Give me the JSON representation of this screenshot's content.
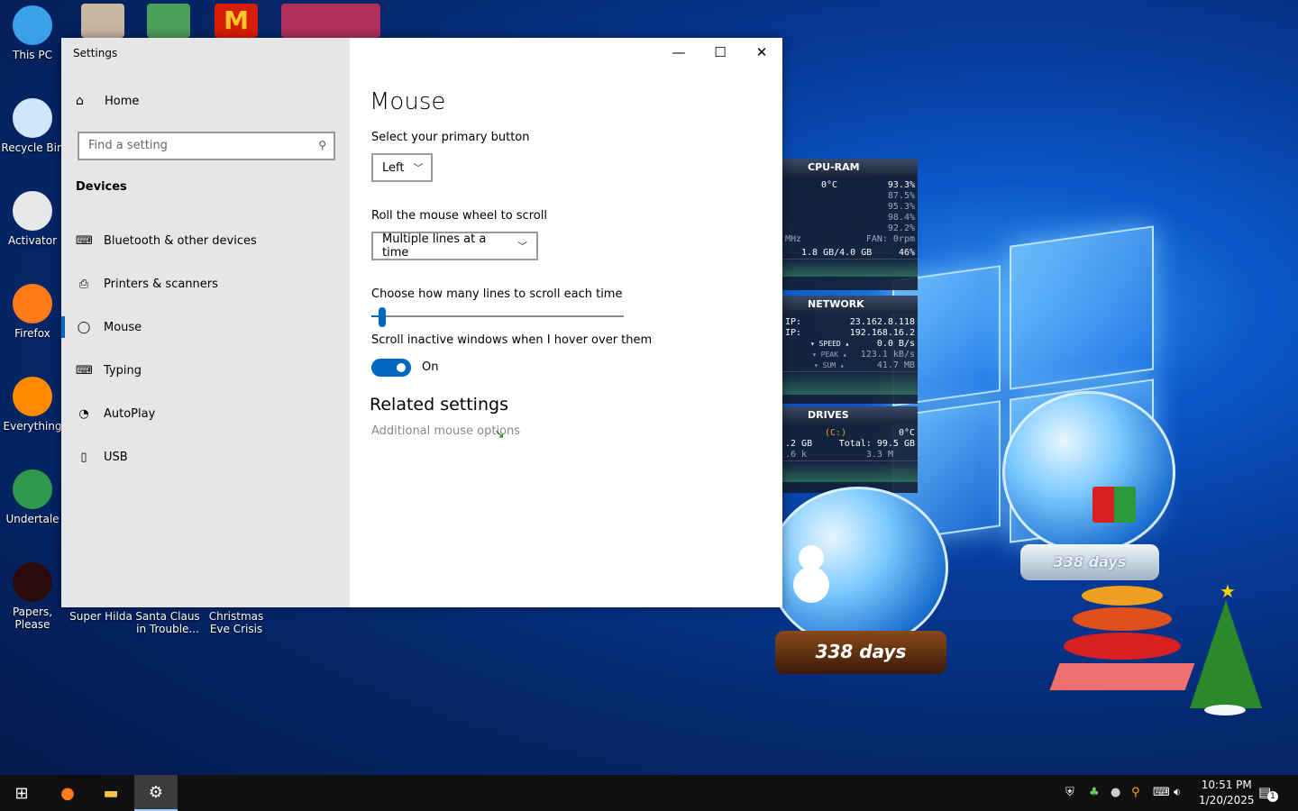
{
  "desktop": {
    "icons": [
      {
        "label": "This PC",
        "icon": "this-pc-icon",
        "color": "#3aa0e8"
      },
      {
        "label": "Recycle Bin",
        "icon": "recycle-bin-icon",
        "color": "#cfe8f8"
      },
      {
        "label": "Activator",
        "icon": "activator-icon",
        "color": "#e8e8e8"
      },
      {
        "label": "Firefox",
        "icon": "firefox-icon",
        "color": "#ff7a18"
      },
      {
        "label": "Everything",
        "icon": "everything-icon",
        "color": "#ff8a00"
      },
      {
        "label": "Undertale",
        "icon": "undertale-icon",
        "color": "#2e9a4a"
      },
      {
        "label": "Papers, Please",
        "icon": "papers-please-icon",
        "color": "#2a0a0a"
      }
    ],
    "bottom_labels": [
      "Super Hilda",
      "Santa Claus in Trouble...",
      "Christmas Eve Crisis"
    ]
  },
  "settings": {
    "window_title": "Settings",
    "controls": {
      "minimize": "—",
      "maximize": "☐",
      "close": "✕"
    },
    "home_label": "Home",
    "search_placeholder": "Find a setting",
    "section": "Devices",
    "nav": [
      {
        "label": "Bluetooth & other devices",
        "icon": "bluetooth-devices-icon",
        "glyph": "⌨"
      },
      {
        "label": "Printers & scanners",
        "icon": "printer-icon",
        "glyph": "⎙"
      },
      {
        "label": "Mouse",
        "icon": "mouse-icon",
        "glyph": "◯",
        "active": true
      },
      {
        "label": "Typing",
        "icon": "keyboard-icon",
        "glyph": "⌨"
      },
      {
        "label": "AutoPlay",
        "icon": "autoplay-icon",
        "glyph": "◔"
      },
      {
        "label": "USB",
        "icon": "usb-icon",
        "glyph": "▯"
      }
    ],
    "page_title": "Mouse",
    "primary_button_label": "Select your primary button",
    "primary_button_value": "Left",
    "scroll_label": "Roll the mouse wheel to scroll",
    "scroll_value": "Multiple lines at a time",
    "lines_label": "Choose how many lines to scroll each time",
    "lines_slider_level": 0.03,
    "inactive_label": "Scroll inactive windows when I hover over them",
    "toggle_state": "On",
    "related_title": "Related settings",
    "related_link": "Additional mouse options",
    "accent": "#0067c0"
  },
  "gadgets": {
    "cpu": {
      "title": "CPU-RAM",
      "temp": "0°C",
      "total": "93.3%",
      "cores": [
        "87.5%",
        "95.3%",
        "98.4%",
        "92.2%"
      ],
      "mhz": "MHz",
      "fan": "FAN: 0rpm",
      "ram": "1.8 GB/4.0 GB",
      "ram_pct": "46%"
    },
    "network": {
      "title": "NETWORK",
      "ip1_label": "IP:",
      "ip1": "23.162.8.118",
      "ip2_label": "IP:",
      "ip2": "192.168.16.2",
      "speed_label": "▾ SPEED ▴",
      "speed": "0.0 B/s",
      "peak_label": "▾ PEAK ▴",
      "peak": "123.1 kB/s",
      "sum_label": "▾ SUM ▴",
      "sum": "41.7 MB"
    },
    "drives": {
      "title": "DRIVES",
      "drive": "(C:)",
      "temp": "0°C",
      "used": ".2 GB",
      "total": "Total: 99.5 GB",
      "io_left": ".6 k",
      "io_right": "3.3 M"
    }
  },
  "globes": {
    "left_days": "338 days",
    "right_days": "338 days"
  },
  "taskbar": {
    "apps": [
      {
        "name": "start-button",
        "glyph": "⊞"
      },
      {
        "name": "firefox-taskbar",
        "glyph": "●"
      },
      {
        "name": "file-explorer-taskbar",
        "glyph": "▬"
      },
      {
        "name": "settings-taskbar",
        "glyph": "⚙",
        "active": true
      }
    ],
    "time": "10:51 PM",
    "date": "1/20/2025",
    "notification_count": "1"
  }
}
